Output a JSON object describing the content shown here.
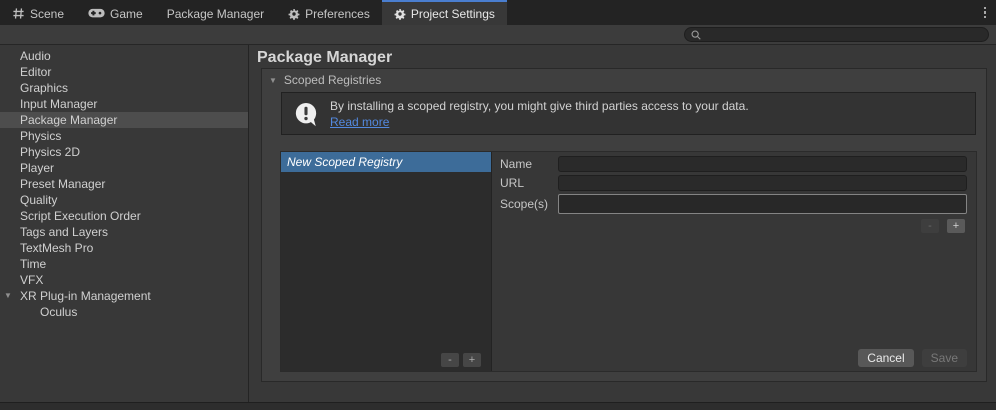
{
  "tab_bar": {
    "tabs": [
      {
        "label": "Scene",
        "icon": "scene-grid-icon"
      },
      {
        "label": "Game",
        "icon": "gamepad-icon"
      },
      {
        "label": "Package Manager",
        "icon": ""
      },
      {
        "label": "Preferences",
        "icon": "gear-icon"
      },
      {
        "label": "Project Settings",
        "icon": "gear-icon",
        "active": true
      }
    ],
    "more_menu_icon": "kebab-menu-icon"
  },
  "toolbar": {
    "search_value": "",
    "search_icon": "magnifier-icon"
  },
  "sidebar": {
    "items": [
      "Audio",
      "Editor",
      "Graphics",
      "Input Manager",
      "Package Manager",
      "Physics",
      "Physics 2D",
      "Player",
      "Preset Manager",
      "Quality",
      "Script Execution Order",
      "Tags and Layers",
      "TextMesh Pro",
      "Time",
      "VFX",
      "XR Plug-in Management",
      "Oculus"
    ],
    "selected_item": "Package Manager"
  },
  "main": {
    "title": "Package Manager",
    "scoped_registries": {
      "title": "Scoped Registries",
      "info": {
        "icon": "speech-bubble-exclamation-icon",
        "message": "By installing a scoped registry, you might give third parties access to your data.",
        "link_label": "Read more"
      },
      "registry_list": {
        "selected_item": "New Scoped Registry",
        "remove_button": "-",
        "add_button": "+"
      },
      "form": {
        "fields": [
          {
            "label": "Name",
            "value": ""
          },
          {
            "label": "URL",
            "value": ""
          },
          {
            "label": "Scope(s)",
            "value": ""
          }
        ],
        "scope_remove_button": "-",
        "scope_add_button": "+",
        "cancel_button": "Cancel",
        "save_button": "Save"
      }
    }
  },
  "colors": {
    "active_tab_accent": "#4a7ecf",
    "list_selection": "#3d6c99",
    "link": "#5389df"
  }
}
